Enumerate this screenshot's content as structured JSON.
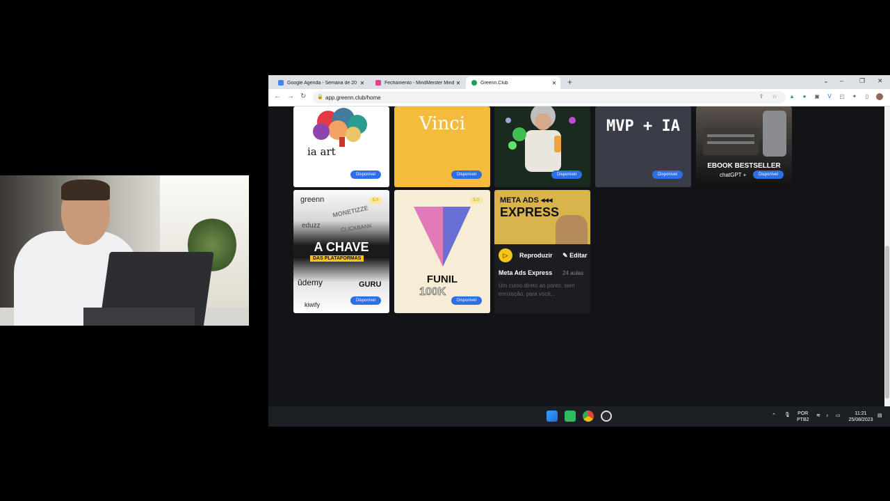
{
  "browser": {
    "tabs": [
      {
        "label": "Google Agenda - Semana de 20",
        "favicon_color": "#4285f4"
      },
      {
        "label": "Fechamento - MindMeister Mind",
        "favicon_color": "#e83e8c"
      },
      {
        "label": "Greenn.Club",
        "favicon_color": "#1e9e5a"
      }
    ],
    "new_tab": "+",
    "url": "app.greenn.club/home"
  },
  "cards_row1": [
    {
      "title": "ia art",
      "badge": "Disponível",
      "bg": "#ffffff"
    },
    {
      "title": "Vinci",
      "badge": "Disponível",
      "bg": "#f5bb3c"
    },
    {
      "title": "",
      "badge": "Disponível",
      "bg": "#1b2a1e"
    },
    {
      "title": "MVP + IA",
      "badge": "Disponível",
      "bg": "#3a3d48"
    },
    {
      "title": "EBOOK BESTSELLER",
      "subtitle": "chatGPT +",
      "badge": "Disponível",
      "bg": "#2a2a2a"
    }
  ],
  "cards_row2": {
    "chave": {
      "logos": [
        "greenn",
        "MONETIZZE",
        "eduzz",
        "CLICKBANK",
        "ûdemy",
        "GURU",
        "kiwify"
      ],
      "title": "A CHAVE",
      "subtitle": "DAS PLATAFORMAS",
      "rating": "5.0",
      "badge": "Disponível"
    },
    "funil": {
      "title": "FUNIL",
      "subtitle": "100K",
      "rating": "5.0",
      "badge": "Disponível"
    },
    "meta": {
      "cover_title_line1": "META ADS ◂◂◂",
      "cover_title_line2": "EXPRESS",
      "play_label": "Reproduzir",
      "edit_label": "Editar",
      "course_title": "Meta Ads Express",
      "lessons": "24 aulas",
      "description": "Um curso direto ao ponto, sem enrolação, para você..."
    }
  },
  "taskbar": {
    "lang_line1": "POR",
    "lang_line2": "PTB2",
    "time": "11:21",
    "date": "25/08/2023"
  }
}
